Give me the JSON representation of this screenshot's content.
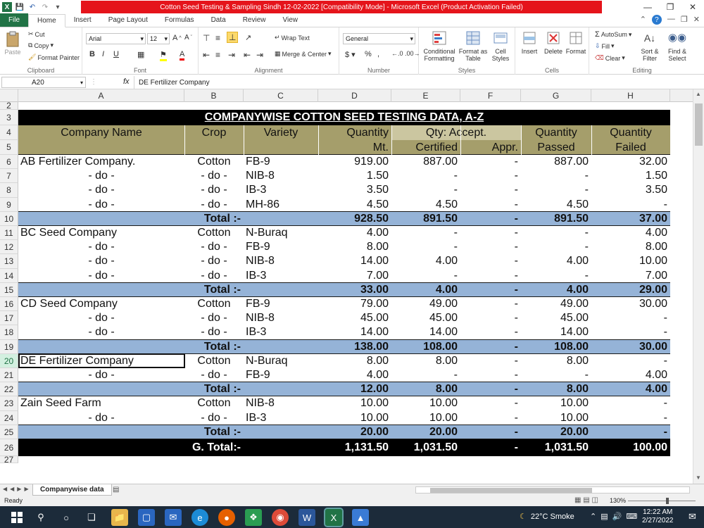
{
  "window": {
    "title": "Cotton Seed Testing & Sampling Sindh 12-02-2022  [Compatibility Mode]  -  Microsoft Excel (Product Activation Failed)"
  },
  "ribbon_tabs": [
    "File",
    "Home",
    "Insert",
    "Page Layout",
    "Formulas",
    "Data",
    "Review",
    "View"
  ],
  "ribbon": {
    "clipboard": {
      "paste": "Paste",
      "cut": "Cut",
      "copy": "Copy",
      "format_painter": "Format Painter",
      "label": "Clipboard"
    },
    "font": {
      "name": "Arial",
      "size": "12",
      "label": "Font"
    },
    "alignment": {
      "wrap_text": "Wrap Text",
      "merge_center": "Merge & Center",
      "label": "Alignment"
    },
    "number": {
      "format": "General",
      "label": "Number"
    },
    "styles": {
      "conditional": "Conditional Formatting",
      "format_table": "Format as Table",
      "cell_styles": "Cell Styles",
      "label": "Styles"
    },
    "cells": {
      "insert": "Insert",
      "delete": "Delete",
      "format": "Format",
      "label": "Cells"
    },
    "editing": {
      "autosum": "AutoSum",
      "fill": "Fill",
      "clear": "Clear",
      "sort_filter": "Sort & Filter",
      "find_select": "Find & Select",
      "label": "Editing"
    }
  },
  "formula_bar": {
    "name_box": "A20",
    "fx": "fx",
    "content": "DE Fertilizer Company"
  },
  "columns": [
    "A",
    "B",
    "C",
    "D",
    "E",
    "F",
    "G",
    "H"
  ],
  "sheet": {
    "title": "COMPANYWISE COTTON SEED TESTING DATA, A-Z",
    "headers": {
      "company": "Company Name",
      "crop": "Crop",
      "variety": "Variety",
      "qty1": "Quantity",
      "qty2": "Mt.",
      "accept": "Qty: Accept.",
      "certified": "Certified",
      "appr": "Appr.",
      "passed1": "Quantity",
      "passed2": "Passed",
      "failed1": "Quantity",
      "failed2": "Failed"
    },
    "rows": [
      {
        "n": "6",
        "type": "data",
        "a": "AB Fertilizer Company.",
        "b": "Cotton",
        "c": "FB-9",
        "d": "919.00",
        "e": "887.00",
        "f": "-",
        "g": "887.00",
        "h": "32.00"
      },
      {
        "n": "7",
        "type": "data",
        "a": "- do -",
        "b": "- do -",
        "c": "NIB-8",
        "d": "1.50",
        "e": "-",
        "f": "-",
        "g": "-",
        "h": "1.50"
      },
      {
        "n": "8",
        "type": "data",
        "a": "- do -",
        "b": "- do -",
        "c": "IB-3",
        "d": "3.50",
        "e": "-",
        "f": "-",
        "g": "-",
        "h": "3.50"
      },
      {
        "n": "9",
        "type": "data",
        "a": "- do -",
        "b": "- do -",
        "c": "MH-86",
        "d": "4.50",
        "e": "4.50",
        "f": "-",
        "g": "4.50",
        "h": "-"
      },
      {
        "n": "10",
        "type": "total",
        "a": "",
        "b": "Total :-",
        "c": "",
        "d": "928.50",
        "e": "891.50",
        "f": "-",
        "g": "891.50",
        "h": "37.00"
      },
      {
        "n": "11",
        "type": "data",
        "a": "BC Seed Company",
        "b": "Cotton",
        "c": "N-Buraq",
        "d": "4.00",
        "e": "-",
        "f": "-",
        "g": "-",
        "h": "4.00"
      },
      {
        "n": "12",
        "type": "data",
        "a": "- do -",
        "b": "- do -",
        "c": "FB-9",
        "d": "8.00",
        "e": "-",
        "f": "-",
        "g": "-",
        "h": "8.00"
      },
      {
        "n": "13",
        "type": "data",
        "a": "- do -",
        "b": "- do -",
        "c": "NIB-8",
        "d": "14.00",
        "e": "4.00",
        "f": "-",
        "g": "4.00",
        "h": "10.00"
      },
      {
        "n": "14",
        "type": "data",
        "a": "- do -",
        "b": "- do -",
        "c": "IB-3",
        "d": "7.00",
        "e": "-",
        "f": "-",
        "g": "-",
        "h": "7.00"
      },
      {
        "n": "15",
        "type": "total",
        "a": "",
        "b": "Total :-",
        "c": "",
        "d": "33.00",
        "e": "4.00",
        "f": "-",
        "g": "4.00",
        "h": "29.00"
      },
      {
        "n": "16",
        "type": "data",
        "a": "CD Seed Company",
        "b": "Cotton",
        "c": "FB-9",
        "d": "79.00",
        "e": "49.00",
        "f": "-",
        "g": "49.00",
        "h": "30.00"
      },
      {
        "n": "17",
        "type": "data",
        "a": "- do -",
        "b": "- do -",
        "c": "NIB-8",
        "d": "45.00",
        "e": "45.00",
        "f": "-",
        "g": "45.00",
        "h": "-"
      },
      {
        "n": "18",
        "type": "data",
        "a": "- do -",
        "b": "- do -",
        "c": "IB-3",
        "d": "14.00",
        "e": "14.00",
        "f": "-",
        "g": "14.00",
        "h": "-"
      },
      {
        "n": "19",
        "type": "total",
        "a": "",
        "b": "Total :-",
        "c": "",
        "d": "138.00",
        "e": "108.00",
        "f": "-",
        "g": "108.00",
        "h": "30.00"
      },
      {
        "n": "20",
        "type": "data",
        "a": "DE Fertilizer Company",
        "b": "Cotton",
        "c": "N-Buraq",
        "d": "8.00",
        "e": "8.00",
        "f": "-",
        "g": "8.00",
        "h": "-"
      },
      {
        "n": "21",
        "type": "data",
        "a": "- do -",
        "b": "- do -",
        "c": "FB-9",
        "d": "4.00",
        "e": "-",
        "f": "-",
        "g": "-",
        "h": "4.00"
      },
      {
        "n": "22",
        "type": "total",
        "a": "",
        "b": "Total :-",
        "c": "",
        "d": "12.00",
        "e": "8.00",
        "f": "-",
        "g": "8.00",
        "h": "4.00"
      },
      {
        "n": "23",
        "type": "data",
        "a": "Zain Seed Farm",
        "b": "Cotton",
        "c": "NIB-8",
        "d": "10.00",
        "e": "10.00",
        "f": "-",
        "g": "10.00",
        "h": "-"
      },
      {
        "n": "24",
        "type": "data",
        "a": "- do -",
        "b": "- do -",
        "c": "IB-3",
        "d": "10.00",
        "e": "10.00",
        "f": "-",
        "g": "10.00",
        "h": "-"
      },
      {
        "n": "25",
        "type": "total",
        "a": "",
        "b": "Total :-",
        "c": "",
        "d": "20.00",
        "e": "20.00",
        "f": "-",
        "g": "20.00",
        "h": "-"
      },
      {
        "n": "26",
        "type": "grand",
        "a": "",
        "b": "G. Total:-",
        "c": "",
        "d": "1,131.50",
        "e": "1,031.50",
        "f": "-",
        "g": "1,031.50",
        "h": "100.00"
      }
    ]
  },
  "row_numbers_top": [
    "2",
    "3",
    "4",
    "5"
  ],
  "row_27": "27",
  "sheet_tab": "Companywise data",
  "status": {
    "ready": "Ready",
    "zoom": "130%"
  },
  "taskbar": {
    "weather": "22°C  Smoke",
    "time": "12:22 AM",
    "date": "2/27/2022"
  },
  "colors": {
    "title_bg": "#000000",
    "header_bg": "#a59e6b",
    "total_bg": "#95b3d7",
    "accent": "#217346",
    "redbar": "#e5141b"
  }
}
